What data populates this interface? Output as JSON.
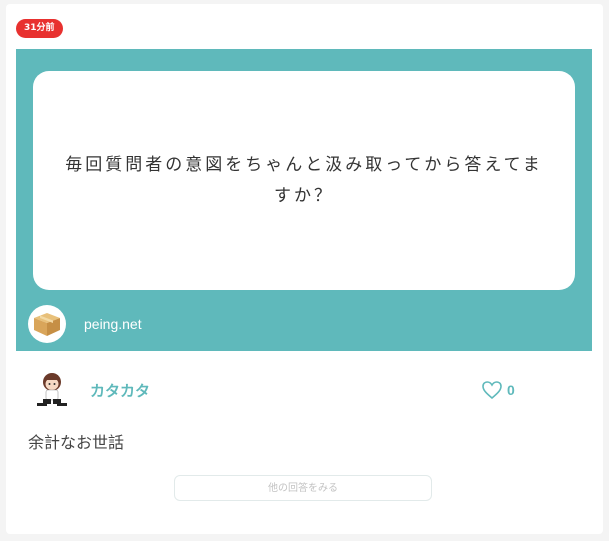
{
  "post": {
    "time_badge": "31分前",
    "question": "毎回質問者の意図をちゃんと汲み取ってから答えてますか？",
    "site_name": "peing.net"
  },
  "answerer": {
    "name": "カタカタ",
    "likes": "0"
  },
  "answer": {
    "text": "余計なお世話"
  },
  "more_button": {
    "label": "他の回答をみる"
  },
  "colors": {
    "accent": "#5fb9bb",
    "badge": "#e8312f"
  },
  "icons": {
    "box": "cardboard-box-icon",
    "heart": "heart-outline-icon"
  }
}
